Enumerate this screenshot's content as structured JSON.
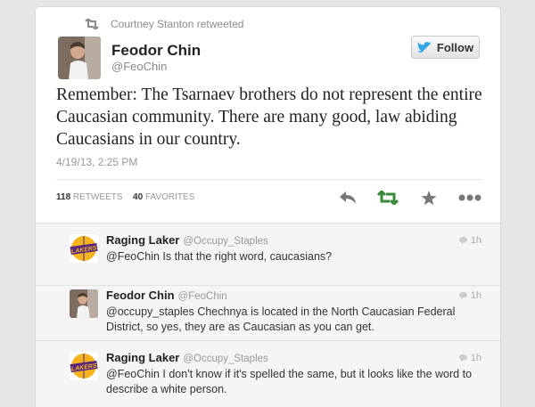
{
  "retweet_context": {
    "text": "Courtney Stanton retweeted"
  },
  "tweet": {
    "author_name": "Feodor Chin",
    "author_handle": "@FeoChin",
    "follow_label": "Follow",
    "text": "Remember: The Tsarnaev brothers do not represent the entire Caucasian community. There are many good, law abiding Caucasians in our country.",
    "timestamp": "4/19/13, 2:25 PM",
    "retweet_count": "118",
    "retweet_label": "RETWEETS",
    "favorite_count": "40",
    "favorite_label": "FAVORITES"
  },
  "replies": [
    {
      "name": "Raging Laker",
      "handle": "@Occupy_Staples",
      "time": "1h",
      "text": "@FeoChin Is that the right word, caucasians?",
      "avatar": "lakers-logo"
    },
    {
      "name": "Feodor Chin",
      "handle": "@FeoChin",
      "time": "1h",
      "text": "@occupy_staples Chechnya is located in the North Caucasian Federal District, so yes, they are as Caucasian as you can get.",
      "avatar": "person-photo"
    },
    {
      "name": "Raging Laker",
      "handle": "@Occupy_Staples",
      "time": "1h",
      "text": "@FeoChin I don't know if it's spelled the same, but it looks like the word to describe a white person.",
      "avatar": "lakers-logo"
    }
  ],
  "lakers_logo_text": "LAKERS",
  "colors": {
    "follow_bird": "#2fa5e4",
    "retweet_green": "#3a8a3a",
    "action_gray": "#777777",
    "lakers_gold": "#f5b320",
    "lakers_purple": "#55257f"
  },
  "icons": [
    "retweet-icon",
    "twitter-bird-icon",
    "reply-icon",
    "retweet-action-icon",
    "favorite-star-icon",
    "more-icon",
    "reply-bubble-icon"
  ]
}
